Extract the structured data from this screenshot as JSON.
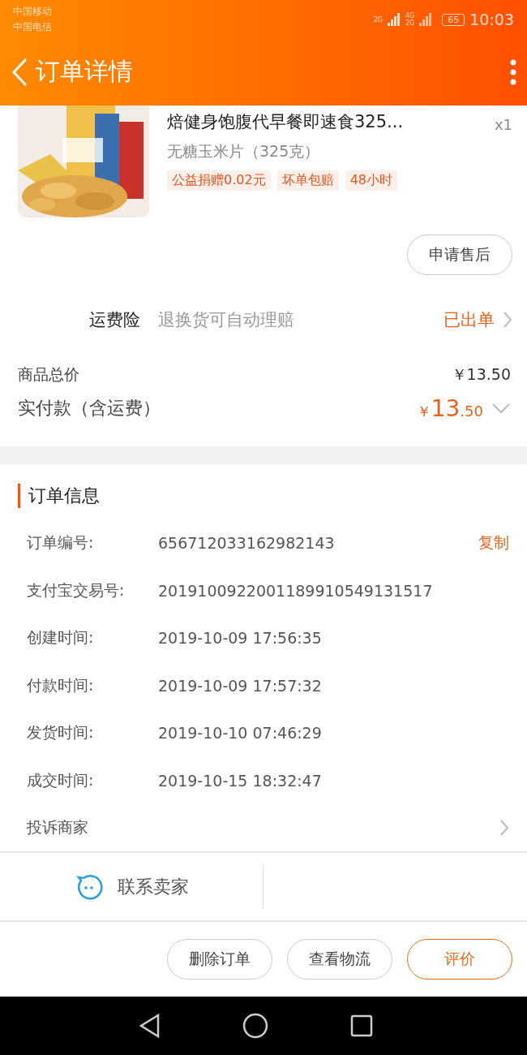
{
  "status_bar": {
    "carriers": [
      "中国移动",
      "中国电信"
    ],
    "network_labels": [
      "2G",
      "4G",
      "2G"
    ],
    "battery": "65",
    "time": "10:03"
  },
  "header": {
    "title": "订单详情"
  },
  "product": {
    "title": "焙健身饱腹代早餐即速食325...",
    "quantity": "x1",
    "spec": "无糖玉米片（325克）",
    "tags": [
      "公益捐赠0.02元",
      "坏单包赔",
      "48小时"
    ]
  },
  "after_sale_button": "申请售后",
  "freight_insurance": {
    "label": "运费险",
    "description": "退换货可自动理赔",
    "status": "已出单"
  },
  "prices": {
    "goods_total_label": "商品总价",
    "goods_total": "￥13.50",
    "paid_label": "实付款（含运费）",
    "paid_currency": "￥",
    "paid_integer": "13",
    "paid_decimal": ".50",
    "expanded": false
  },
  "order_info": {
    "title": "订单信息",
    "rows": [
      {
        "label": "订单编号:",
        "value": "656712033162982143",
        "action": "复制"
      },
      {
        "label": "支付宝交易号:",
        "value": "2019100922001189910549131517"
      },
      {
        "label": "创建时间:",
        "value": "2019-10-09 17:56:35"
      },
      {
        "label": "付款时间:",
        "value": "2019-10-09 17:57:32"
      },
      {
        "label": "发货时间:",
        "value": "2019-10-10 07:46:29"
      },
      {
        "label": "成交时间:",
        "value": "2019-10-15 18:32:47"
      }
    ],
    "complaint": "投诉商家"
  },
  "contact": "联系卖家",
  "actions": [
    {
      "label": "删除订单",
      "primary": false
    },
    {
      "label": "查看物流",
      "primary": false
    },
    {
      "label": "评价",
      "primary": true
    }
  ]
}
